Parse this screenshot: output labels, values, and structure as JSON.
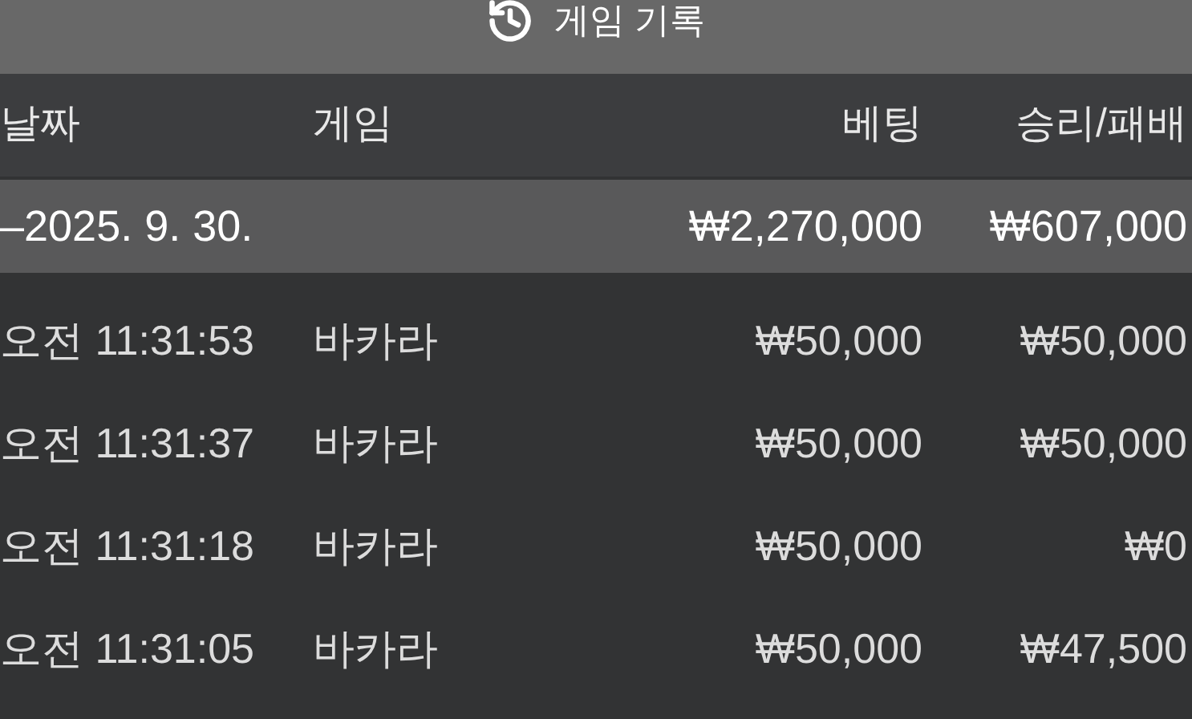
{
  "title": "게임 기록",
  "columns": [
    "날짜",
    "게임",
    "베팅",
    "승리/패배"
  ],
  "date_group": {
    "date": "–2025. 9. 30.",
    "bet": "₩2,270,000",
    "result": "₩607,000"
  },
  "rows": [
    {
      "time": "오전 11:31:53",
      "game": "바카라",
      "bet": "₩50,000",
      "result": "₩50,000"
    },
    {
      "time": "오전 11:31:37",
      "game": "바카라",
      "bet": "₩50,000",
      "result": "₩50,000"
    },
    {
      "time": "오전 11:31:18",
      "game": "바카라",
      "bet": "₩50,000",
      "result": "₩0"
    },
    {
      "time": "오전 11:31:05",
      "game": "바카라",
      "bet": "₩50,000",
      "result": "₩47,500"
    }
  ]
}
